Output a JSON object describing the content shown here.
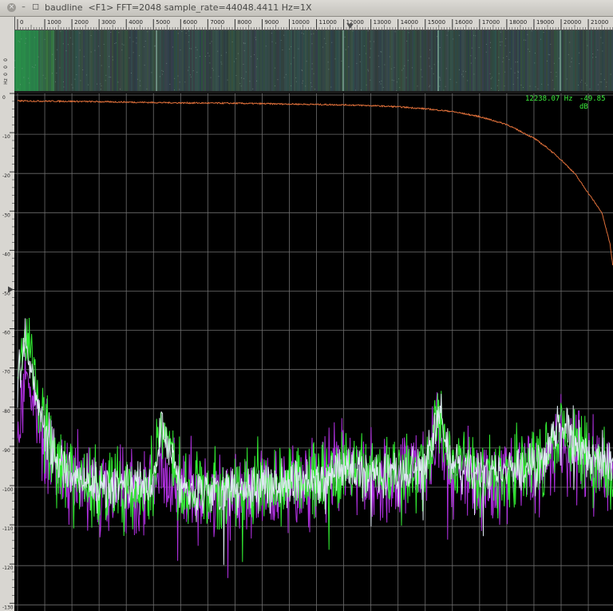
{
  "window": {
    "title": "baudline  <F1> FFT=2048 sample_rate=44048.4411 Hz=1X",
    "close_label": "×",
    "min_label": "–",
    "max_label": "□"
  },
  "ruler": {
    "labels": [
      "0",
      "1000",
      "2000",
      "3000",
      "4000",
      "5000",
      "6000",
      "7000",
      "8000",
      "9000",
      "10000",
      "11000",
      "12000",
      "13000",
      "14000",
      "15000",
      "16000",
      "17000",
      "18000",
      "19000",
      "20000",
      "21000"
    ],
    "cursor_hz": 12238.07
  },
  "waterfall_axis": {
    "labels": [
      "0",
      "0",
      "0",
      "Hz"
    ]
  },
  "spectrum_axis": {
    "labels": [
      "0",
      "-10",
      "-20",
      "-30",
      "-40",
      "-50",
      "-60",
      "-70",
      "-80",
      "-90",
      "-100",
      "-110",
      "-120",
      "-130"
    ],
    "range_db": [
      0,
      -130
    ],
    "marker_db": -50
  },
  "readout": {
    "frequency": "12238.07 Hz",
    "level": "-49.85 dB"
  },
  "colors": {
    "response_curve": "#e0703a",
    "trace_a": "#33ee33",
    "trace_b": "#b030e0",
    "overlap": "#dde8f0",
    "grid": "#6e6e6e",
    "readout": "#3cf03c"
  },
  "chart_data": {
    "type": "line",
    "x_unit": "Hz",
    "y_unit": "dB",
    "xlim": [
      0,
      22024
    ],
    "ylim": [
      -130,
      0
    ],
    "series": [
      {
        "x": [
          0,
          2000,
          4000,
          6000,
          8000,
          10000,
          12000,
          13000,
          14000,
          15000,
          16000,
          17000,
          18000,
          19000,
          19500,
          20000,
          20500,
          21000,
          21500,
          21800,
          22000
        ],
        "y": [
          -1.5,
          -1.6,
          -1.8,
          -2,
          -2.1,
          -2.3,
          -2.5,
          -2.7,
          -3,
          -3.5,
          -4.2,
          -5.5,
          -7.5,
          -11,
          -13.5,
          -16.5,
          -20,
          -25,
          -30,
          -38,
          -49
        ]
      },
      {
        "x": [
          0,
          300,
          600,
          1000,
          1500,
          2000,
          3000,
          4000,
          5000,
          5300,
          6000,
          7000,
          8000,
          9000,
          10000,
          11000,
          12000,
          13000,
          14000,
          15000,
          15500,
          16000,
          17000,
          18000,
          19000,
          20000,
          21000,
          22000
        ],
        "y": [
          -75,
          -60,
          -72,
          -85,
          -95,
          -98,
          -100,
          -100,
          -99,
          -82,
          -100,
          -101,
          -101,
          -100,
          -99,
          -98,
          -96,
          -96,
          -97,
          -95,
          -80,
          -95,
          -96,
          -96,
          -95,
          -84,
          -92,
          -95
        ]
      },
      {
        "x": [
          0,
          300,
          600,
          1000,
          1500,
          2000,
          3000,
          4000,
          5000,
          5300,
          6000,
          7000,
          8000,
          9000,
          10000,
          11000,
          12000,
          13000,
          14000,
          15000,
          15500,
          16000,
          17000,
          18000,
          19000,
          20000,
          21000,
          22000
        ],
        "y": [
          -80,
          -72,
          -78,
          -88,
          -96,
          -99,
          -101,
          -101,
          -100,
          -92,
          -101,
          -102,
          -102,
          -101,
          -100,
          -99,
          -95,
          -97,
          -98,
          -96,
          -88,
          -96,
          -97,
          -97,
          -96,
          -88,
          -94,
          -96
        ]
      }
    ]
  }
}
